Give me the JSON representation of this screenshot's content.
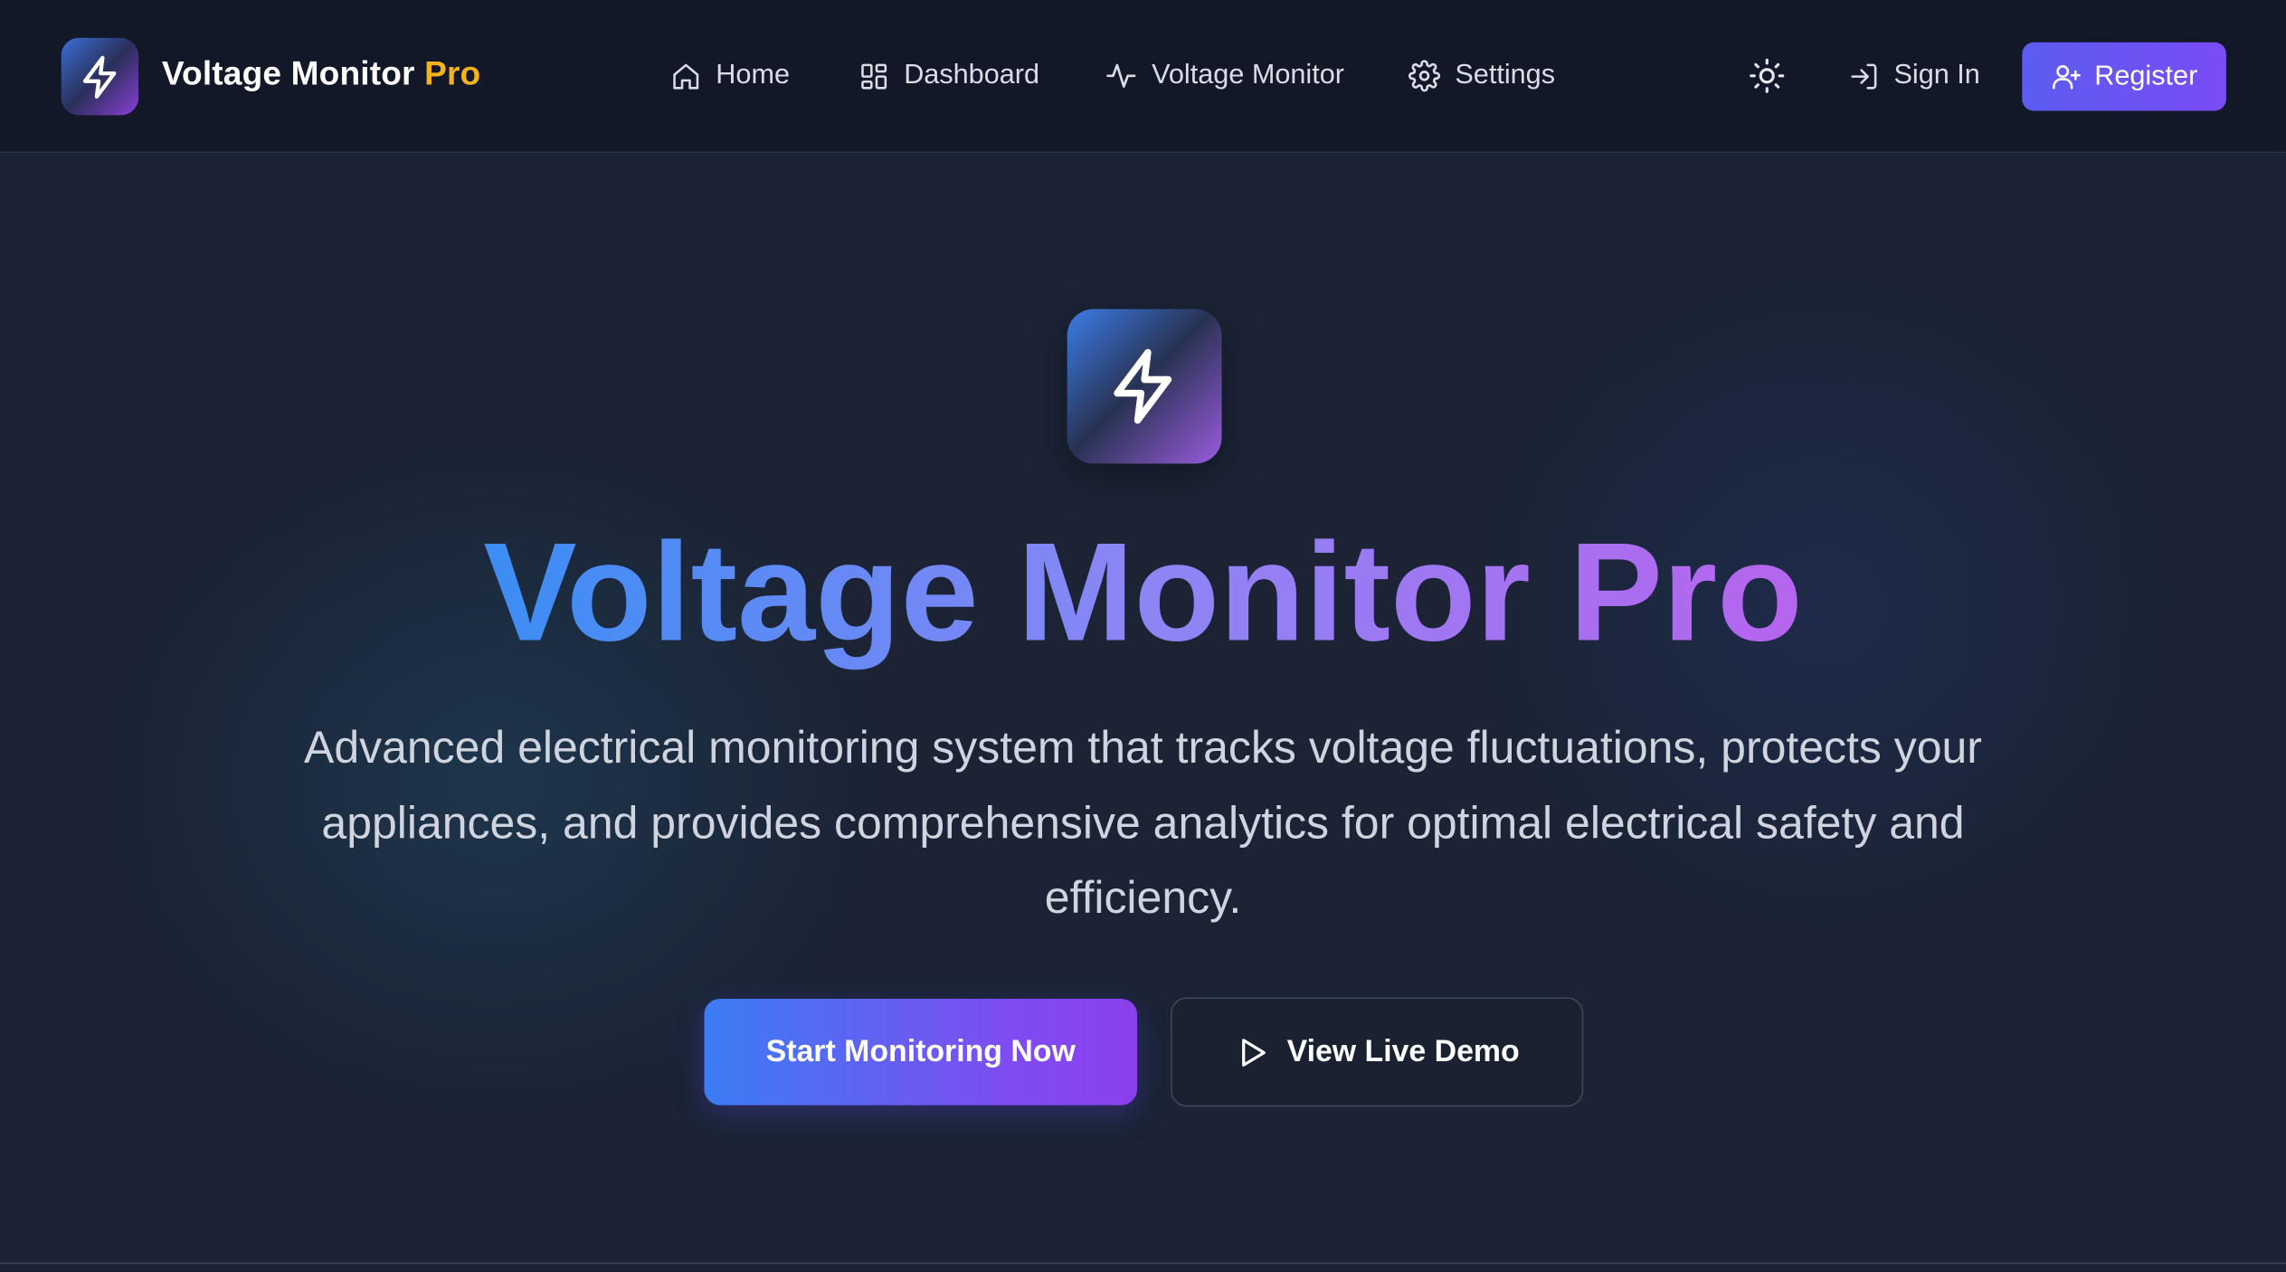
{
  "brand": {
    "name": "Voltage Monitor",
    "accent": "Pro",
    "logo_icon": "lightning-bolt-icon"
  },
  "nav": {
    "links": [
      {
        "label": "Home",
        "icon": "home-icon"
      },
      {
        "label": "Dashboard",
        "icon": "dashboard-grid-icon"
      },
      {
        "label": "Voltage Monitor",
        "icon": "activity-pulse-icon"
      },
      {
        "label": "Settings",
        "icon": "gear-icon"
      }
    ],
    "theme_toggle_icon": "sun-icon",
    "sign_in": {
      "label": "Sign In",
      "icon": "sign-in-icon"
    },
    "register": {
      "label": "Register",
      "icon": "user-plus-icon"
    }
  },
  "hero": {
    "icon": "lightning-bolt-icon",
    "title": "Voltage Monitor Pro",
    "description": "Advanced electrical monitoring system that tracks voltage fluctuations, protects your appliances, and provides comprehensive analytics for optimal electrical safety and efficiency.",
    "primary_cta": "Start Monitoring Now",
    "secondary_cta": {
      "label": "View Live Demo",
      "icon": "play-icon"
    }
  },
  "colors": {
    "background": "#1a2233",
    "nav_background": "#121828",
    "brand_accent": "#f5b21a",
    "primary_button": "#5b5cf2",
    "gradient_blue": "#3d8df5",
    "gradient_purple": "#b565ee"
  }
}
